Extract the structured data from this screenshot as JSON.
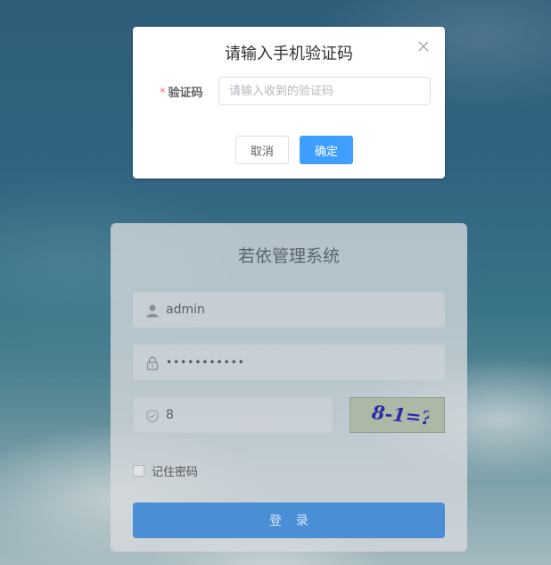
{
  "login": {
    "title": "若依管理系统",
    "username": "admin",
    "password_mask": "•••••••••••",
    "captcha_answer": "8",
    "captcha_text": "8-1=?",
    "remember_label": "记住密码",
    "login_button": "登 录"
  },
  "dialog": {
    "title": "请输入手机验证码",
    "field_required_mark": "*",
    "field_label": "验证码",
    "field_placeholder": "请输入收到的验证码",
    "field_value": "",
    "cancel_label": "取消",
    "confirm_label": "确定"
  },
  "icons": {
    "user": "user-icon",
    "lock": "lock-icon",
    "shield": "shield-icon",
    "close": "close-icon"
  },
  "colors": {
    "primary": "#409eff",
    "required": "#f56c6c",
    "login_button": "#4a8fd6"
  }
}
